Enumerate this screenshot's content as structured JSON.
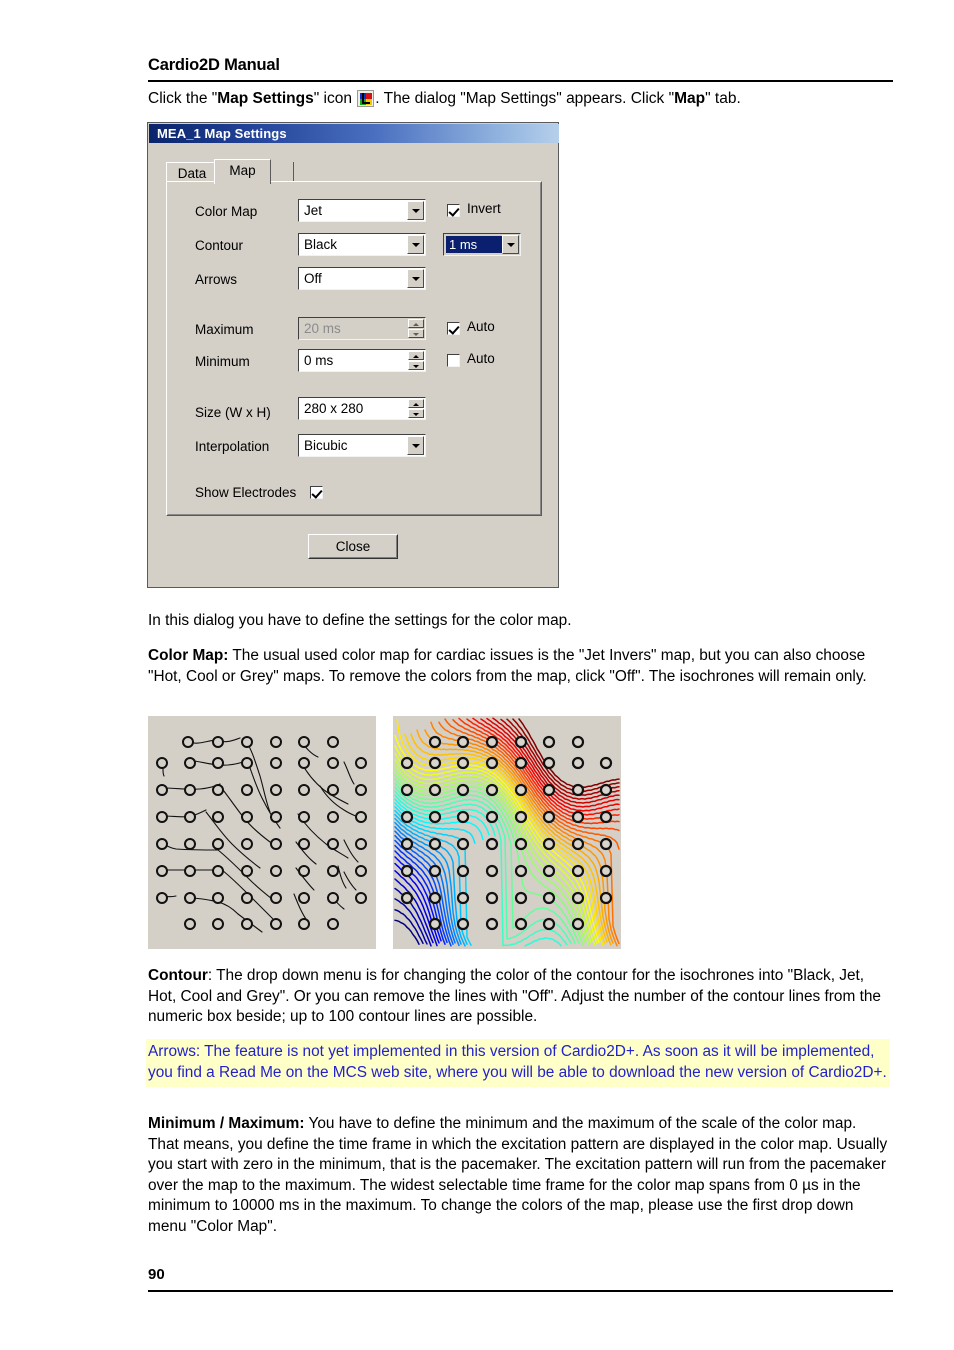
{
  "header": {
    "manual_title": "Cardio2D Manual",
    "page_number": "90"
  },
  "intro": {
    "part1": "Click the \"",
    "bold1": "Map Settings",
    "part2": "\" icon ",
    "icon_name": "map-settings-icon",
    "part3": ". The dialog \"Map Settings\" appears. Click \"",
    "bold2": "Map",
    "part4": "\" tab."
  },
  "dialog": {
    "title": "MEA_1  Map Settings",
    "tabs": [
      {
        "label": "Data",
        "active": false
      },
      {
        "label": "Map",
        "active": true
      }
    ],
    "fields": {
      "color_map": {
        "label": "Color Map",
        "value": "Jet"
      },
      "contour": {
        "label": "Contour",
        "value": "Black"
      },
      "arrows": {
        "label": "Arrows",
        "value": "Off"
      },
      "maximum": {
        "label": "Maximum",
        "value": "20 ms",
        "disabled": true
      },
      "minimum": {
        "label": "Minimum",
        "value": "0 ms",
        "disabled": false
      },
      "size": {
        "label": "Size (W x H)",
        "value": "280 x 280"
      },
      "interpolation": {
        "label": "Interpolation",
        "value": "Bicubic"
      },
      "show_electrodes": {
        "label": "Show Electrodes",
        "checked": true
      }
    },
    "invert": {
      "label": "Invert",
      "checked": true
    },
    "contour_count": {
      "value": "1 ms"
    },
    "auto_max": {
      "label": "Auto",
      "checked": true
    },
    "auto_min": {
      "label": "Auto",
      "checked": false
    },
    "close_button": "Close"
  },
  "body": {
    "p_intro": "In this dialog you have to define the settings for the color map.",
    "p_colormap_bold": "Color Map:",
    "p_colormap": " The usual used color map for cardiac issues is the \"Jet Invers\" map, but you can also choose \"Hot, Cool or Grey\" maps. To remove the colors from the map, click \"Off\". The isochrones will remain only.",
    "p_contour_bold": "Contour",
    "p_contour": ": The drop down menu is for changing the color of the contour for the isochrones into \"Black, Jet, Hot, Cool and Grey\". Or you can remove the lines with \"Off\". Adjust the number of the contour lines from the numeric box beside; up to 100 contour lines are possible.",
    "p_arrows_note": "Arrows: The feature is not yet implemented in this version of Cardio2D+. As soon as it will be implemented, you find a Read Me on the MCS web site, where you will be able to download the new version of Cardio2D+.",
    "p_minmax_bold": "Minimum / Maximum:",
    "p_minmax": " You have to define the minimum and the maximum of the scale of the color map. That means, you define the time frame in which the excitation pattern are displayed in the color map. Usually you start with zero in the minimum, that is the pacemaker. The excitation pattern will run from the pacemaker over the map to the maximum. The widest selectable time frame for the color map spans from 0 µs in the minimum to 10000 ms in the maximum. To change the colors of the map, please use the first drop down menu \"Color Map\"."
  },
  "figures": {
    "left": {
      "name": "isochrone-map-black",
      "caption": "",
      "background": "#d4d0c8",
      "contour_color": "#000000",
      "electrode_rows": 8,
      "electrode_cols": 8,
      "corners_removed": true
    },
    "right": {
      "name": "isochrone-map-jet",
      "caption": "",
      "background": "#d4d0c8",
      "contour_colormap": "jet",
      "electrode_rows": 8,
      "electrode_cols": 8,
      "corners_removed": true
    }
  },
  "colors": {
    "dialog_face": "#d4d0c8",
    "titlebar_dark": "#0a246a",
    "titlebar_light": "#b6cfeb",
    "note_bg": "#ffffc8",
    "note_text": "#2222cc"
  }
}
